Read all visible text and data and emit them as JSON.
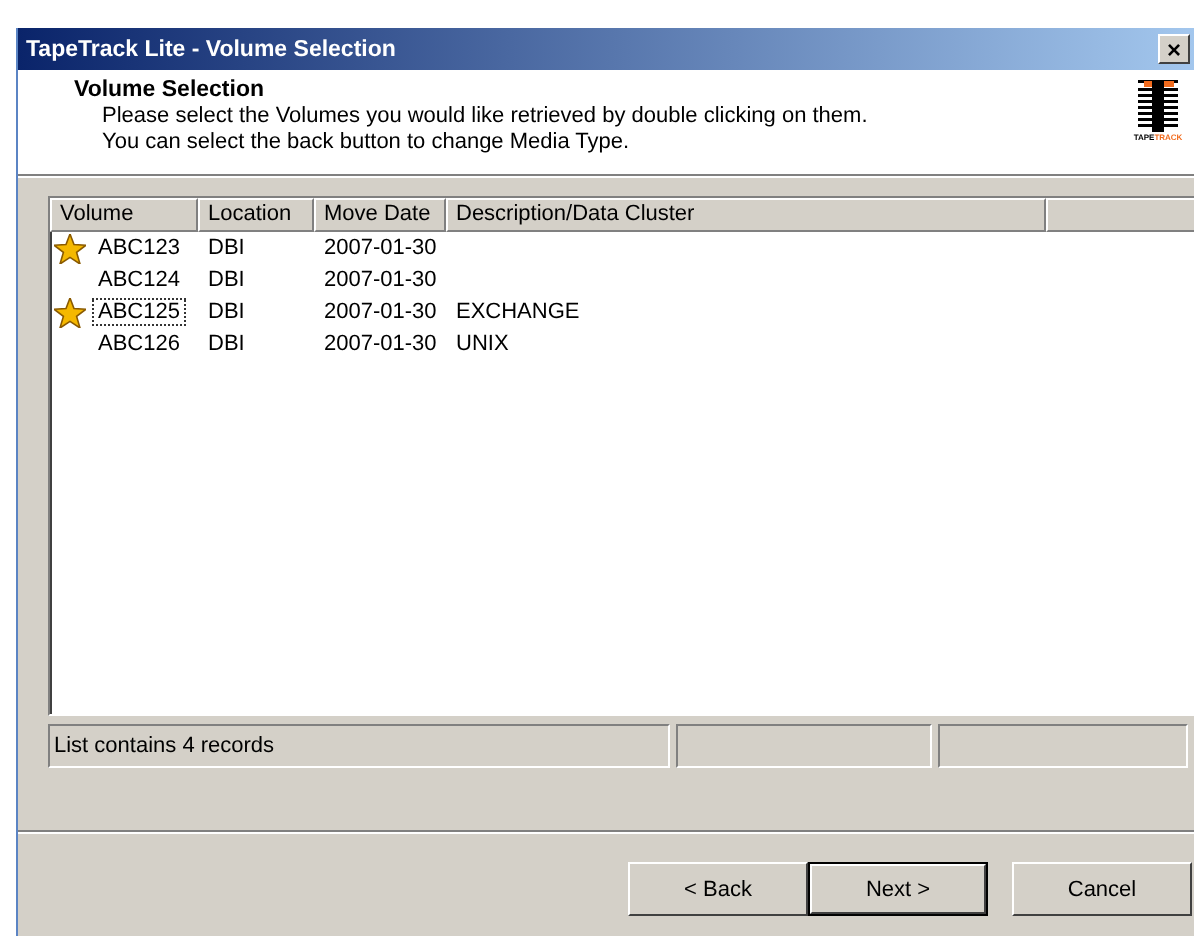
{
  "window": {
    "title": "TapeTrack Lite - Volume Selection",
    "close": "×"
  },
  "header": {
    "title": "Volume Selection",
    "lines": [
      "Please select the Volumes you would like retrieved by double clicking on them.",
      "You can select the back button to change Media Type."
    ],
    "logo": {
      "part1": "TAPE",
      "part2": "TRACK"
    }
  },
  "table": {
    "columns": [
      "Volume",
      "Location",
      "Move Date",
      "Description/Data Cluster"
    ],
    "rows": [
      {
        "starred": true,
        "focused": false,
        "cells": [
          "ABC123",
          "DBI",
          "2007-01-30",
          ""
        ]
      },
      {
        "starred": false,
        "focused": false,
        "cells": [
          "ABC124",
          "DBI",
          "2007-01-30",
          ""
        ]
      },
      {
        "starred": true,
        "focused": true,
        "cells": [
          "ABC125",
          "DBI",
          "2007-01-30",
          "EXCHANGE"
        ]
      },
      {
        "starred": false,
        "focused": false,
        "cells": [
          "ABC126",
          "DBI",
          "2007-01-30",
          "UNIX"
        ]
      }
    ]
  },
  "status_bar": [
    "List contains 4 records"
  ],
  "buttons": [
    {
      "label": "< Back",
      "default": false
    },
    {
      "label": "Next >",
      "default": true
    },
    {
      "label": "Cancel",
      "default": false
    }
  ]
}
